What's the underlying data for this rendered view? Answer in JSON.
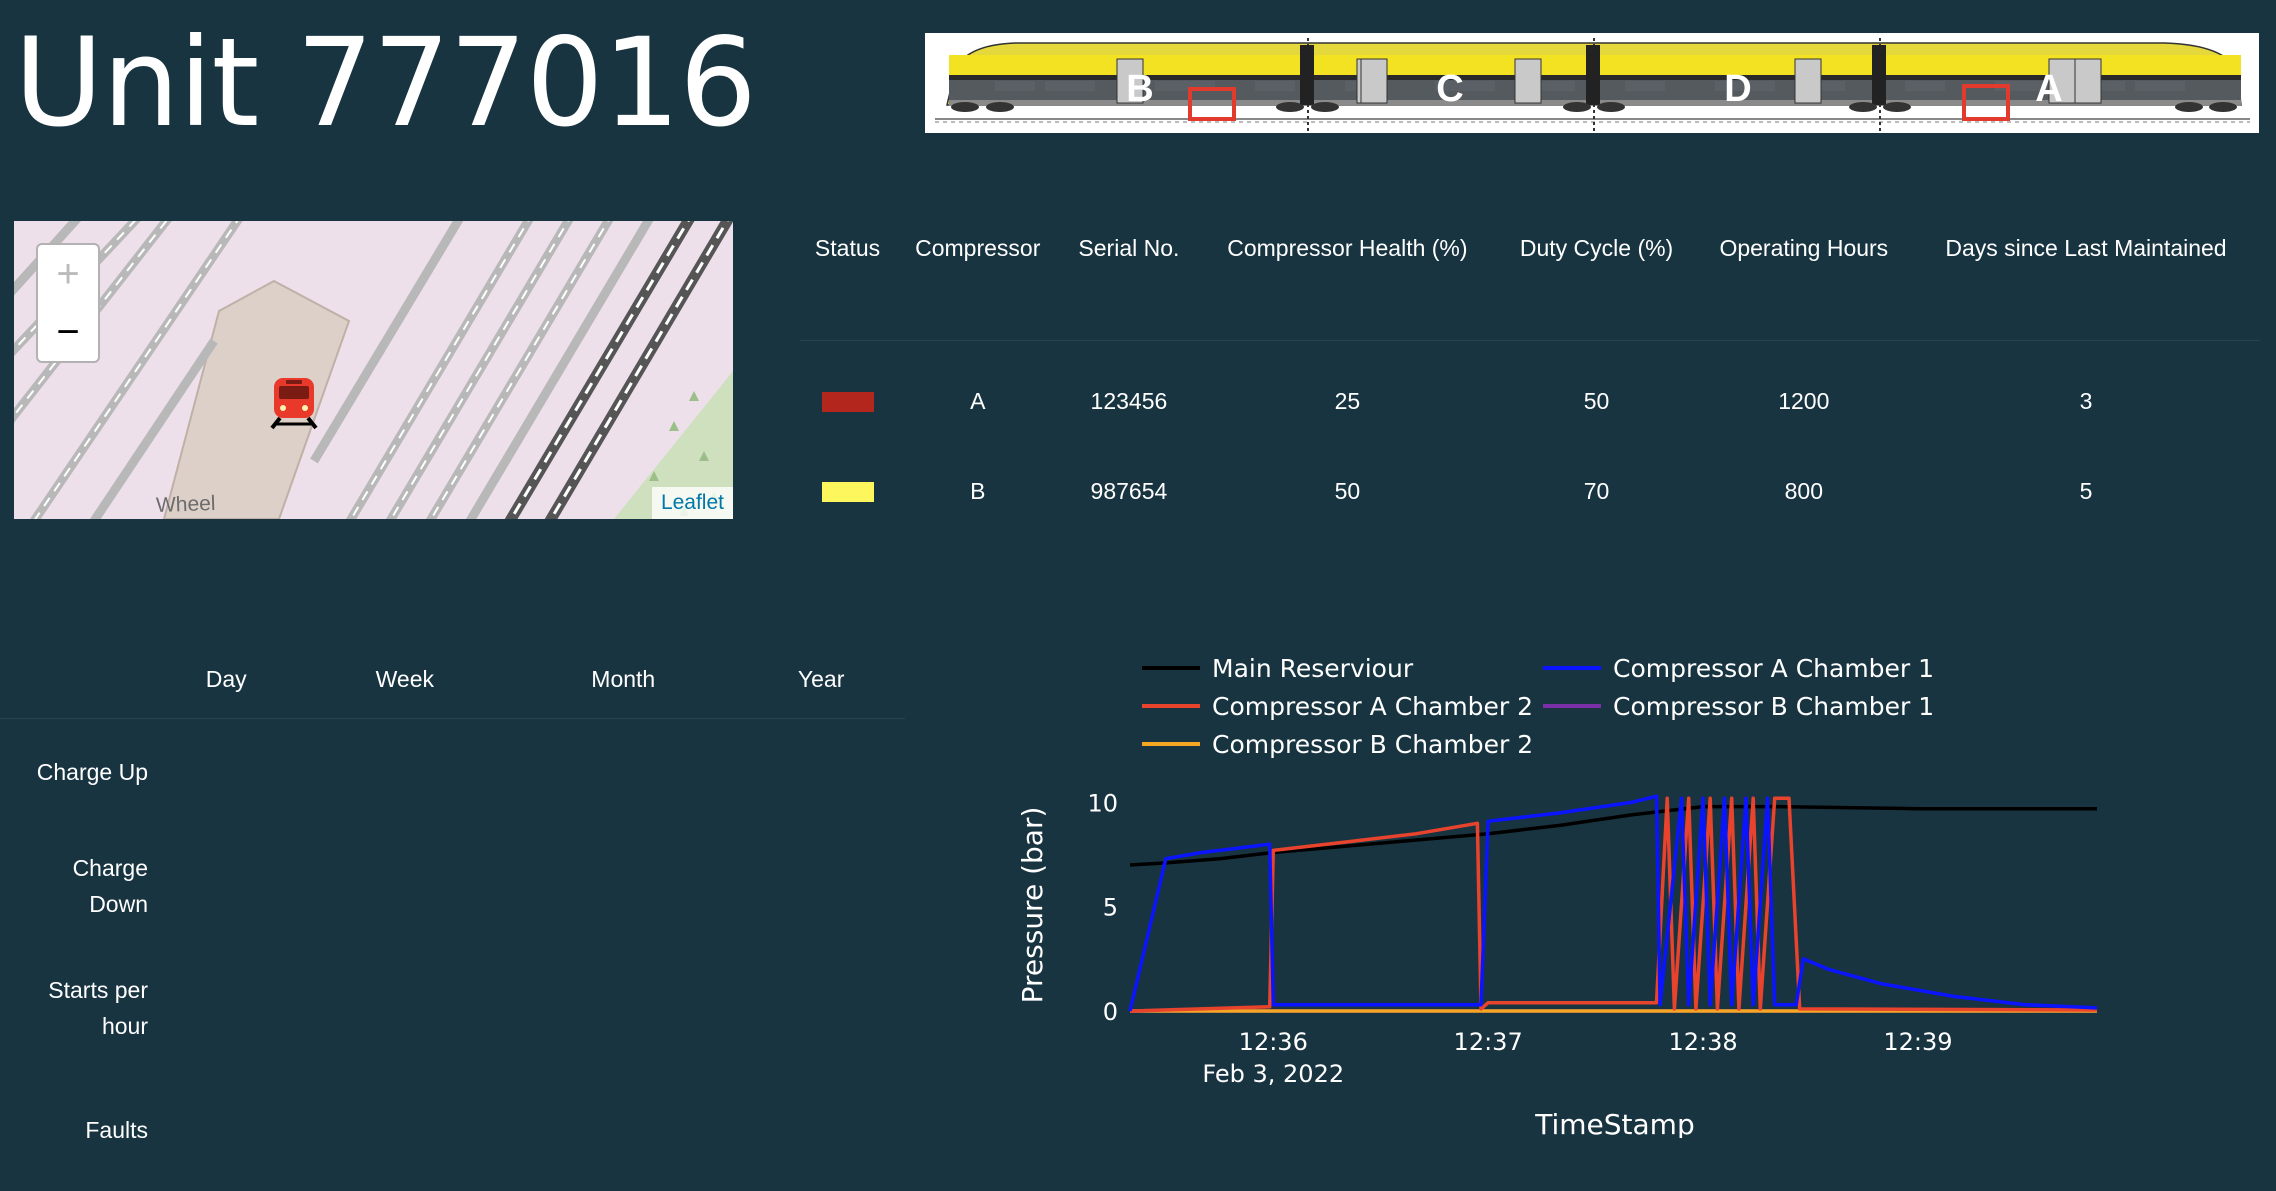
{
  "page": {
    "title": "Unit 777016"
  },
  "train": {
    "car_labels": [
      "B",
      "C",
      "D",
      "A"
    ],
    "highlight_color": "#e23b2e",
    "body_color": "#f3e221"
  },
  "map": {
    "zoom_in": "+",
    "zoom_out": "−",
    "attribution": "Leaflet",
    "place_label": "Wheel",
    "marker_icon": "train-icon"
  },
  "compressor_table": {
    "columns": [
      "Status",
      "Compressor",
      "Serial No.",
      "Compressor Health (%)",
      "Duty Cycle (%)",
      "Operating Hours",
      "Days since Last Maintained"
    ],
    "rows": [
      {
        "status_color": "#b3261e",
        "compressor": "A",
        "serial": "123456",
        "health": "25",
        "duty": "50",
        "hours": "1200",
        "days": "3"
      },
      {
        "status_color": "#fdf65c",
        "compressor": "B",
        "serial": "987654",
        "health": "50",
        "duty": "70",
        "hours": "800",
        "days": "5"
      }
    ]
  },
  "stats_table": {
    "columns": [
      "Day",
      "Week",
      "Month",
      "Year"
    ],
    "rows": [
      "Charge Up",
      "Charge Down",
      "Starts per hour",
      "Faults"
    ]
  },
  "chart_data": {
    "type": "line",
    "title": "",
    "xlabel": "TimeStamp",
    "ylabel": "Pressure (bar)",
    "ylim": [
      0,
      10.5
    ],
    "x_range": [
      "12:35:20",
      "12:39:50"
    ],
    "x_ticks": [
      "12:36",
      "12:37",
      "12:38",
      "12:39"
    ],
    "x_date_label": "Feb 3, 2022",
    "y_ticks": [
      0,
      5,
      10
    ],
    "legend_position": "top",
    "series": [
      {
        "name": "Main Reserviour",
        "color": "#000000",
        "points": [
          [
            "12:35:20",
            7.0
          ],
          [
            "12:35:30",
            7.1
          ],
          [
            "12:35:45",
            7.3
          ],
          [
            "12:36:00",
            7.6
          ],
          [
            "12:36:20",
            7.9
          ],
          [
            "12:36:40",
            8.2
          ],
          [
            "12:37:00",
            8.5
          ],
          [
            "12:37:20",
            8.9
          ],
          [
            "12:37:40",
            9.4
          ],
          [
            "12:38:00",
            9.8
          ],
          [
            "12:38:20",
            9.8
          ],
          [
            "12:38:40",
            9.75
          ],
          [
            "12:39:00",
            9.7
          ],
          [
            "12:39:20",
            9.7
          ],
          [
            "12:39:50",
            9.7
          ]
        ]
      },
      {
        "name": "Compressor A Chamber 1",
        "color": "#0a14ff",
        "points": [
          [
            "12:35:20",
            0
          ],
          [
            "12:35:30",
            7.3
          ],
          [
            "12:35:40",
            7.6
          ],
          [
            "12:35:50",
            7.8
          ],
          [
            "12:35:59",
            8.0
          ],
          [
            "12:36:00",
            0.3
          ],
          [
            "12:36:58",
            0.3
          ],
          [
            "12:37:00",
            9.1
          ],
          [
            "12:37:20",
            9.5
          ],
          [
            "12:37:40",
            10.0
          ],
          [
            "12:37:47",
            10.3
          ],
          [
            "12:37:48",
            0.3
          ],
          [
            "12:37:54",
            10.2
          ],
          [
            "12:37:56",
            0.3
          ],
          [
            "12:38:00",
            10.2
          ],
          [
            "12:38:02",
            0.3
          ],
          [
            "12:38:06",
            10.2
          ],
          [
            "12:38:08",
            0.3
          ],
          [
            "12:38:12",
            10.2
          ],
          [
            "12:38:14",
            0.3
          ],
          [
            "12:38:18",
            10.2
          ],
          [
            "12:38:20",
            0.3
          ],
          [
            "12:38:26",
            0.3
          ],
          [
            "12:38:28",
            2.5
          ],
          [
            "12:38:35",
            2.0
          ],
          [
            "12:38:50",
            1.3
          ],
          [
            "12:39:10",
            0.7
          ],
          [
            "12:39:30",
            0.3
          ],
          [
            "12:39:50",
            0.15
          ]
        ]
      },
      {
        "name": "Compressor A Chamber 2",
        "color": "#e8432c",
        "points": [
          [
            "12:35:20",
            0
          ],
          [
            "12:35:59",
            0.2
          ],
          [
            "12:36:00",
            7.7
          ],
          [
            "12:36:20",
            8.1
          ],
          [
            "12:36:40",
            8.5
          ],
          [
            "12:36:57",
            9.0
          ],
          [
            "12:36:58",
            0.1
          ],
          [
            "12:37:00",
            0.4
          ],
          [
            "12:37:47",
            0.4
          ],
          [
            "12:37:50",
            10.2
          ],
          [
            "12:37:52",
            0.1
          ],
          [
            "12:37:56",
            10.2
          ],
          [
            "12:37:58",
            0.1
          ],
          [
            "12:38:02",
            10.2
          ],
          [
            "12:38:04",
            0.1
          ],
          [
            "12:38:08",
            10.2
          ],
          [
            "12:38:10",
            0.1
          ],
          [
            "12:38:14",
            10.2
          ],
          [
            "12:38:16",
            0.1
          ],
          [
            "12:38:20",
            10.2
          ],
          [
            "12:38:24",
            10.2
          ],
          [
            "12:38:27",
            0.1
          ],
          [
            "12:39:50",
            0.05
          ]
        ]
      },
      {
        "name": "Compressor B Chamber 1",
        "color": "#7a2ea8",
        "points": [
          [
            "12:35:20",
            0
          ],
          [
            "12:39:50",
            0
          ]
        ]
      },
      {
        "name": "Compressor B Chamber 2",
        "color": "#f5a623",
        "points": [
          [
            "12:35:20",
            0
          ],
          [
            "12:39:50",
            0
          ]
        ]
      }
    ]
  }
}
